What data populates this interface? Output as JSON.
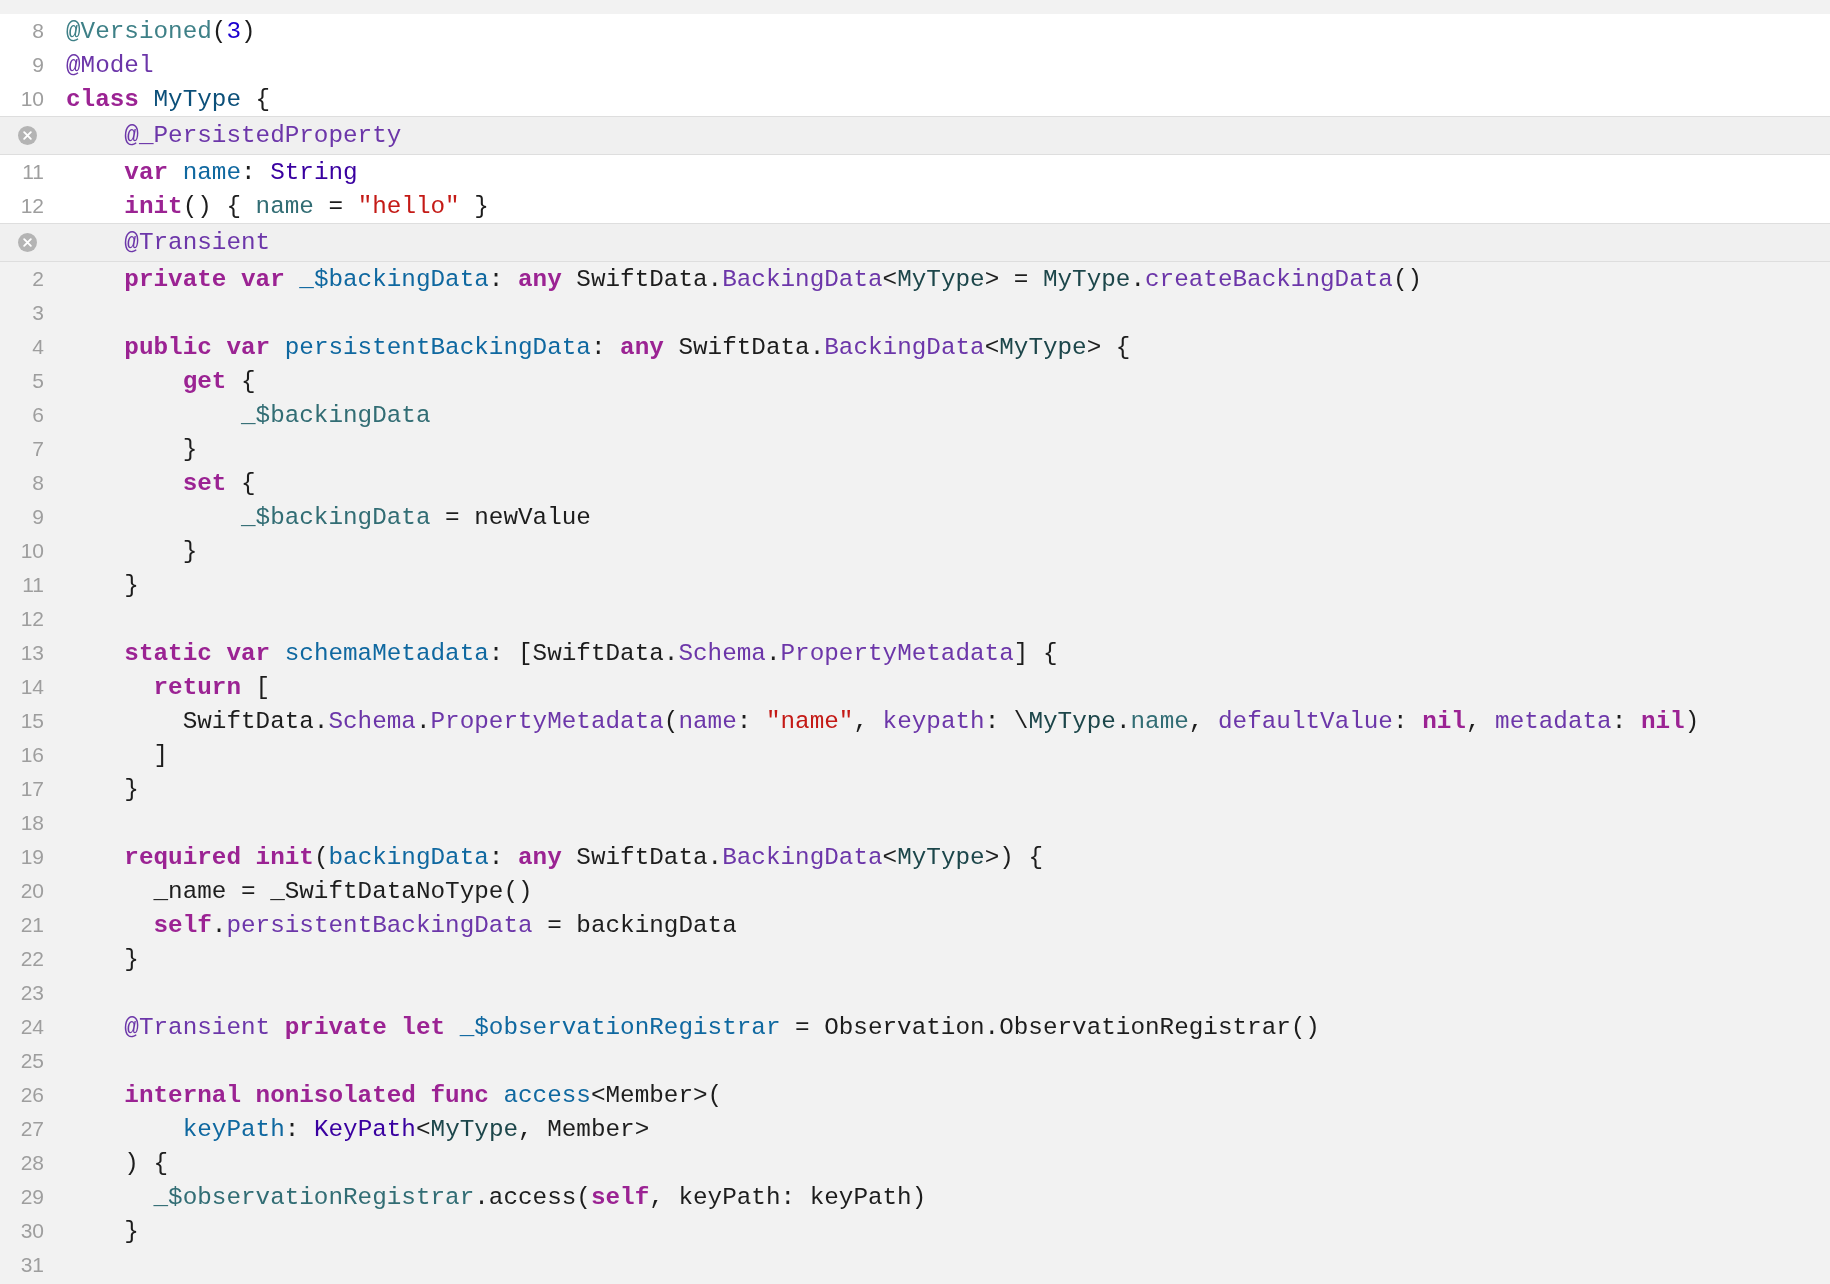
{
  "editor": {
    "lines": [
      {
        "kind": "source",
        "number": "8",
        "tokens": [
          {
            "kind": "proj",
            "text": "@Versioned"
          },
          {
            "kind": "plain",
            "text": "("
          },
          {
            "kind": "num",
            "text": "3"
          },
          {
            "kind": "plain",
            "text": ")"
          }
        ]
      },
      {
        "kind": "source",
        "number": "9",
        "tokens": [
          {
            "kind": "lib",
            "text": "@Model"
          }
        ]
      },
      {
        "kind": "source",
        "number": "10",
        "tokens": [
          {
            "kind": "kw",
            "text": "class "
          },
          {
            "kind": "typedecl",
            "text": "MyType"
          },
          {
            "kind": "plain",
            "text": " {"
          }
        ]
      },
      {
        "kind": "header",
        "tokens": [
          {
            "kind": "lib",
            "text": "    @_PersistedProperty"
          }
        ]
      },
      {
        "kind": "source",
        "number": "11",
        "tokens": [
          {
            "kind": "kw",
            "text": "    var "
          },
          {
            "kind": "decl",
            "text": "name"
          },
          {
            "kind": "plain",
            "text": ": "
          },
          {
            "kind": "libtype",
            "text": "String"
          }
        ]
      },
      {
        "kind": "source",
        "number": "12",
        "tokens": [
          {
            "kind": "kw",
            "text": "    init"
          },
          {
            "kind": "plain",
            "text": "() { "
          },
          {
            "kind": "projmem",
            "text": "name"
          },
          {
            "kind": "plain",
            "text": " = "
          },
          {
            "kind": "str",
            "text": "\"hello\""
          },
          {
            "kind": "plain",
            "text": " }"
          }
        ]
      },
      {
        "kind": "header",
        "tokens": [
          {
            "kind": "lib",
            "text": "    @Transient"
          }
        ]
      },
      {
        "kind": "expansion",
        "number": "2",
        "tokens": [
          {
            "kind": "kw",
            "text": "    private var "
          },
          {
            "kind": "decl",
            "text": "_$backingData"
          },
          {
            "kind": "plain",
            "text": ": "
          },
          {
            "kind": "kw",
            "text": "any"
          },
          {
            "kind": "plain",
            "text": " SwiftData."
          },
          {
            "kind": "lib",
            "text": "BackingData"
          },
          {
            "kind": "plain",
            "text": "<"
          },
          {
            "kind": "projtype",
            "text": "MyType"
          },
          {
            "kind": "plain",
            "text": "> = "
          },
          {
            "kind": "projtype",
            "text": "MyType"
          },
          {
            "kind": "plain",
            "text": "."
          },
          {
            "kind": "lib",
            "text": "createBackingData"
          },
          {
            "kind": "plain",
            "text": "()"
          }
        ]
      },
      {
        "kind": "expansion",
        "number": "3"
      },
      {
        "kind": "expansion",
        "number": "4",
        "tokens": [
          {
            "kind": "kw",
            "text": "    public var "
          },
          {
            "kind": "decl",
            "text": "persistentBackingData"
          },
          {
            "kind": "plain",
            "text": ": "
          },
          {
            "kind": "kw",
            "text": "any"
          },
          {
            "kind": "plain",
            "text": " SwiftData."
          },
          {
            "kind": "lib",
            "text": "BackingData"
          },
          {
            "kind": "plain",
            "text": "<"
          },
          {
            "kind": "projtype",
            "text": "MyType"
          },
          {
            "kind": "plain",
            "text": "> {"
          }
        ]
      },
      {
        "kind": "expansion",
        "number": "5",
        "tokens": [
          {
            "kind": "kw",
            "text": "        get"
          },
          {
            "kind": "plain",
            "text": " {"
          }
        ]
      },
      {
        "kind": "expansion",
        "number": "6",
        "tokens": [
          {
            "kind": "projmem",
            "text": "            _$backingData"
          }
        ]
      },
      {
        "kind": "expansion",
        "number": "7",
        "tokens": [
          {
            "kind": "plain",
            "text": "        }"
          }
        ]
      },
      {
        "kind": "expansion",
        "number": "8",
        "tokens": [
          {
            "kind": "kw",
            "text": "        set"
          },
          {
            "kind": "plain",
            "text": " {"
          }
        ]
      },
      {
        "kind": "expansion",
        "number": "9",
        "tokens": [
          {
            "kind": "projmem",
            "text": "            _$backingData"
          },
          {
            "kind": "plain",
            "text": " = newValue"
          }
        ]
      },
      {
        "kind": "expansion",
        "number": "10",
        "tokens": [
          {
            "kind": "plain",
            "text": "        }"
          }
        ]
      },
      {
        "kind": "expansion",
        "number": "11",
        "tokens": [
          {
            "kind": "plain",
            "text": "    }"
          }
        ]
      },
      {
        "kind": "expansion",
        "number": "12"
      },
      {
        "kind": "expansion",
        "number": "13",
        "tokens": [
          {
            "kind": "kw",
            "text": "    static var "
          },
          {
            "kind": "decl",
            "text": "schemaMetadata"
          },
          {
            "kind": "plain",
            "text": ": [SwiftData."
          },
          {
            "kind": "lib",
            "text": "Schema"
          },
          {
            "kind": "plain",
            "text": "."
          },
          {
            "kind": "lib",
            "text": "PropertyMetadata"
          },
          {
            "kind": "plain",
            "text": "] {"
          }
        ]
      },
      {
        "kind": "expansion",
        "number": "14",
        "tokens": [
          {
            "kind": "kw",
            "text": "      return"
          },
          {
            "kind": "plain",
            "text": " ["
          }
        ]
      },
      {
        "kind": "expansion",
        "number": "15",
        "tokens": [
          {
            "kind": "plain",
            "text": "        SwiftData."
          },
          {
            "kind": "lib",
            "text": "Schema"
          },
          {
            "kind": "plain",
            "text": "."
          },
          {
            "kind": "lib",
            "text": "PropertyMetadata"
          },
          {
            "kind": "plain",
            "text": "("
          },
          {
            "kind": "lib",
            "text": "name"
          },
          {
            "kind": "plain",
            "text": ": "
          },
          {
            "kind": "str",
            "text": "\"name\""
          },
          {
            "kind": "plain",
            "text": ", "
          },
          {
            "kind": "lib",
            "text": "keypath"
          },
          {
            "kind": "plain",
            "text": ": \\"
          },
          {
            "kind": "projtype",
            "text": "MyType"
          },
          {
            "kind": "plain",
            "text": "."
          },
          {
            "kind": "projmem",
            "text": "name"
          },
          {
            "kind": "plain",
            "text": ", "
          },
          {
            "kind": "lib",
            "text": "defaultValue"
          },
          {
            "kind": "plain",
            "text": ": "
          },
          {
            "kind": "kw",
            "text": "nil"
          },
          {
            "kind": "plain",
            "text": ", "
          },
          {
            "kind": "lib",
            "text": "metadata"
          },
          {
            "kind": "plain",
            "text": ": "
          },
          {
            "kind": "kw",
            "text": "nil"
          },
          {
            "kind": "plain",
            "text": ")"
          }
        ]
      },
      {
        "kind": "expansion",
        "number": "16",
        "tokens": [
          {
            "kind": "plain",
            "text": "      ]"
          }
        ]
      },
      {
        "kind": "expansion",
        "number": "17",
        "tokens": [
          {
            "kind": "plain",
            "text": "    }"
          }
        ]
      },
      {
        "kind": "expansion",
        "number": "18"
      },
      {
        "kind": "expansion",
        "number": "19",
        "tokens": [
          {
            "kind": "kw",
            "text": "    required init"
          },
          {
            "kind": "plain",
            "text": "("
          },
          {
            "kind": "decl",
            "text": "backingData"
          },
          {
            "kind": "plain",
            "text": ": "
          },
          {
            "kind": "kw",
            "text": "any"
          },
          {
            "kind": "plain",
            "text": " SwiftData."
          },
          {
            "kind": "lib",
            "text": "BackingData"
          },
          {
            "kind": "plain",
            "text": "<"
          },
          {
            "kind": "projtype",
            "text": "MyType"
          },
          {
            "kind": "plain",
            "text": ">) {"
          }
        ]
      },
      {
        "kind": "expansion",
        "number": "20",
        "tokens": [
          {
            "kind": "plain",
            "text": "      _name = _SwiftDataNoType()"
          }
        ]
      },
      {
        "kind": "expansion",
        "number": "21",
        "tokens": [
          {
            "kind": "kw",
            "text": "      self"
          },
          {
            "kind": "plain",
            "text": "."
          },
          {
            "kind": "lib",
            "text": "persistentBackingData"
          },
          {
            "kind": "plain",
            "text": " = backingData"
          }
        ]
      },
      {
        "kind": "expansion",
        "number": "22",
        "tokens": [
          {
            "kind": "plain",
            "text": "    }"
          }
        ]
      },
      {
        "kind": "expansion",
        "number": "23"
      },
      {
        "kind": "expansion",
        "number": "24",
        "tokens": [
          {
            "kind": "lib",
            "text": "    @Transient "
          },
          {
            "kind": "kw",
            "text": "private let "
          },
          {
            "kind": "decl",
            "text": "_$observationRegistrar"
          },
          {
            "kind": "plain",
            "text": " = Observation.ObservationRegistrar()"
          }
        ]
      },
      {
        "kind": "expansion",
        "number": "25"
      },
      {
        "kind": "expansion",
        "number": "26",
        "tokens": [
          {
            "kind": "kw",
            "text": "    internal nonisolated func "
          },
          {
            "kind": "decl",
            "text": "access"
          },
          {
            "kind": "plain",
            "text": "<Member>("
          }
        ]
      },
      {
        "kind": "expansion",
        "number": "27",
        "tokens": [
          {
            "kind": "decl",
            "text": "        keyPath"
          },
          {
            "kind": "plain",
            "text": ": "
          },
          {
            "kind": "libtype",
            "text": "KeyPath"
          },
          {
            "kind": "plain",
            "text": "<"
          },
          {
            "kind": "projtype",
            "text": "MyType"
          },
          {
            "kind": "plain",
            "text": ", Member>"
          }
        ]
      },
      {
        "kind": "expansion",
        "number": "28",
        "tokens": [
          {
            "kind": "plain",
            "text": "    ) {"
          }
        ]
      },
      {
        "kind": "expansion",
        "number": "29",
        "tokens": [
          {
            "kind": "projmem",
            "text": "      _$observationRegistrar"
          },
          {
            "kind": "plain",
            "text": ".access("
          },
          {
            "kind": "kw",
            "text": "self"
          },
          {
            "kind": "plain",
            "text": ", keyPath: keyPath)"
          }
        ]
      },
      {
        "kind": "expansion",
        "number": "30",
        "tokens": [
          {
            "kind": "plain",
            "text": "    }"
          }
        ]
      },
      {
        "kind": "expansion",
        "number": "31"
      }
    ]
  }
}
